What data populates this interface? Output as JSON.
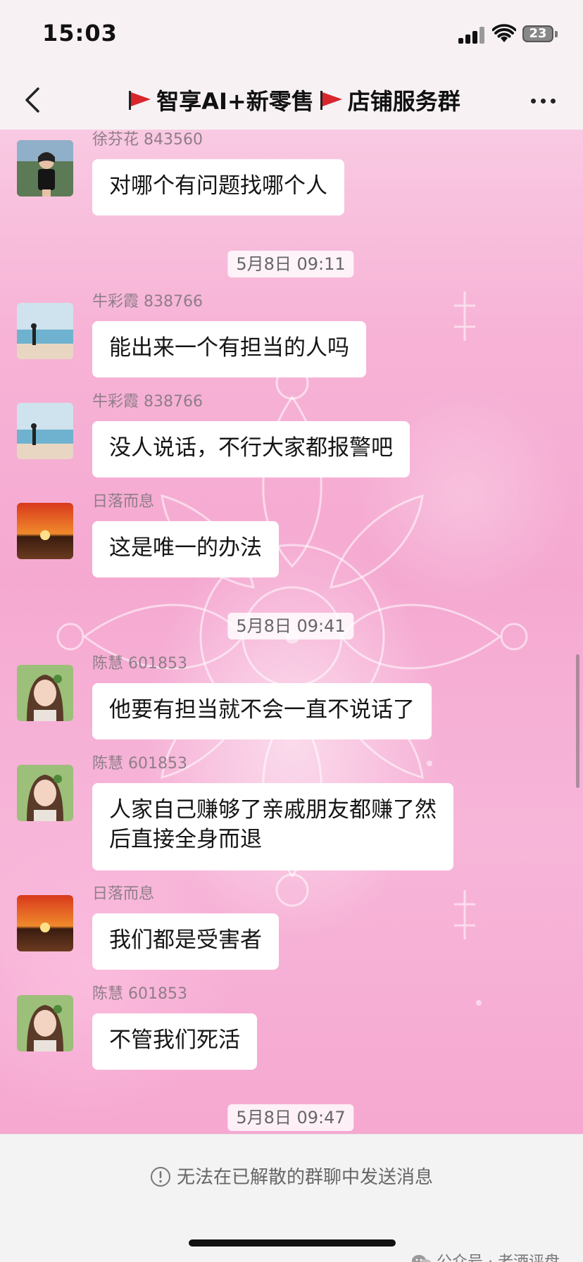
{
  "status_bar": {
    "time": "15:03",
    "battery": "23",
    "icons": [
      "signal-icon",
      "wifi-icon",
      "battery-icon"
    ]
  },
  "nav": {
    "title_part1": "智享AI+新零售",
    "title_part2": "店铺服务群",
    "icons": {
      "back": "chevron-left-icon",
      "more": "more-dots-icon",
      "flag": "red-flag-icon"
    }
  },
  "messages": [
    {
      "sender": "徐芬花 843560",
      "text": "对哪个有问题找哪个人",
      "avatar": "woman-photo"
    },
    {
      "sender": "牛彩霞 838766",
      "text": "能出来一个有担当的人吗",
      "avatar": "beach-photo"
    },
    {
      "sender": "牛彩霞 838766",
      "text": "没人说话，不行大家都报警吧",
      "avatar": "beach-photo"
    },
    {
      "sender": "日落而息",
      "text": "这是唯一的办法",
      "avatar": "sunset-photo"
    },
    {
      "sender": "陈慧 601853",
      "text": "他要有担当就不会一直不说话了",
      "avatar": "girl-photo"
    },
    {
      "sender": "陈慧 601853",
      "text": "人家自己赚够了亲戚朋友都赚了然\n后直接全身而退",
      "avatar": "girl-photo"
    },
    {
      "sender": "日落而息",
      "text": "我们都是受害者",
      "avatar": "sunset-photo"
    },
    {
      "sender": "陈慧 601853",
      "text": "不管我们死活",
      "avatar": "girl-photo"
    }
  ],
  "timestamps": [
    "5月8日 09:11",
    "5月8日 09:41",
    "5月8日 09:47"
  ],
  "footer": {
    "notice": "无法在已解散的群聊中发送消息",
    "watermark": "公众号 · 老酒评盘"
  },
  "colors": {
    "chat_bg": "#f7b3d6",
    "bubble": "#ffffff",
    "flag": "#d8262c",
    "sender_text": "#8f7d88"
  }
}
